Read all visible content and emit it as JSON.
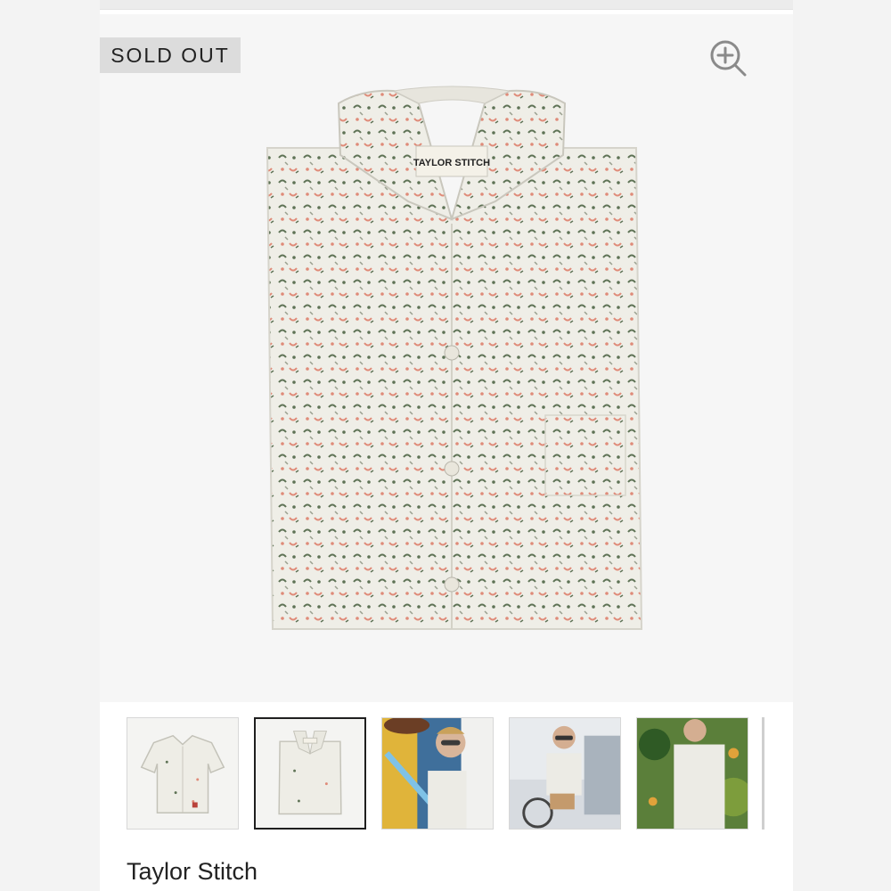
{
  "product": {
    "badge": "SOLD OUT",
    "brand": "Taylor Stitch",
    "label_text": "TAYLOR STITCH"
  },
  "icons": {
    "zoom": "zoom-in-icon"
  },
  "thumbnails": [
    {
      "name": "thumbnail-shirt-flat",
      "selected": false
    },
    {
      "name": "thumbnail-shirt-folded",
      "selected": true
    },
    {
      "name": "thumbnail-model-bike",
      "selected": false
    },
    {
      "name": "thumbnail-model-riding",
      "selected": false
    },
    {
      "name": "thumbnail-model-side",
      "selected": false
    }
  ],
  "colors": {
    "shirt_base": "#efeee7",
    "print_green": "#5f7356",
    "print_pink": "#df8b79",
    "accent_dark": "#1f1f1f"
  }
}
